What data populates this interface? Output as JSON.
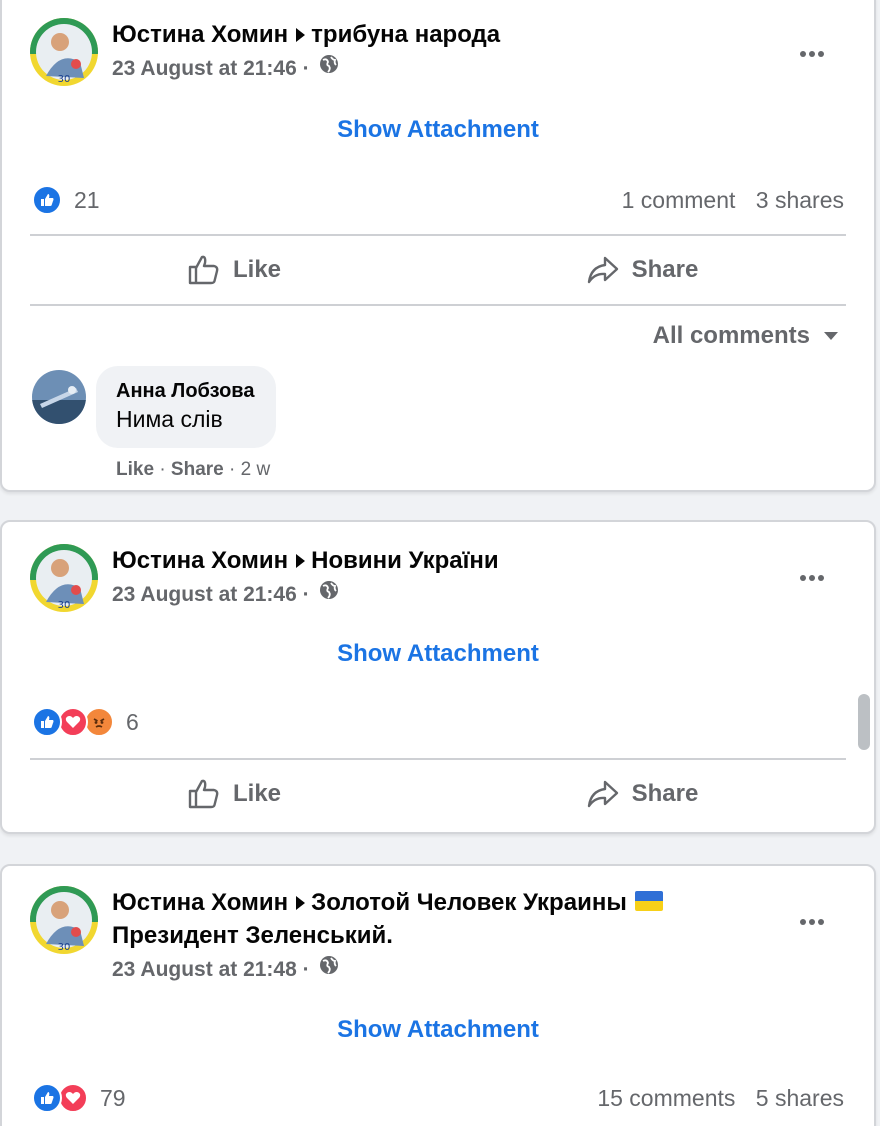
{
  "posts": [
    {
      "author": "Юстина Хомин",
      "group": "трибуна народа",
      "time": "23 August at 21:46",
      "attachment_label": "Show Attachment",
      "reaction_count": "21",
      "reactions": [
        "like-icon"
      ],
      "comments_label": "1 comment",
      "shares_label": "3 shares",
      "like_label": "Like",
      "share_label": "Share",
      "all_comments_label": "All comments",
      "comment": {
        "name": "Анна Лобзова",
        "text": "Нима слів",
        "like": "Like",
        "share": "Share",
        "age": "2 w"
      }
    },
    {
      "author": "Юстина Хомин",
      "group": "Новини України",
      "time": "23 August at 21:46",
      "attachment_label": "Show Attachment",
      "reaction_count": "6",
      "reactions": [
        "like-icon",
        "love-icon",
        "angry-icon"
      ],
      "like_label": "Like",
      "share_label": "Share"
    },
    {
      "author": "Юстина Хомин",
      "group_line1": "Золотой Человек Украины",
      "group_line2": "Президент Зеленський.",
      "time": "23 August at 21:48",
      "attachment_label": "Show Attachment",
      "reaction_count": "79",
      "reactions": [
        "like-icon",
        "love-icon"
      ],
      "comments_label": "15 comments",
      "shares_label": "5 shares"
    }
  ],
  "colors": {
    "accent": "#1b74e4",
    "secondary_text": "#65676b",
    "love": "#f33e58",
    "angry": "#f3873b",
    "flag_blue": "#2f6fd6",
    "flag_yellow": "#f7d018"
  }
}
